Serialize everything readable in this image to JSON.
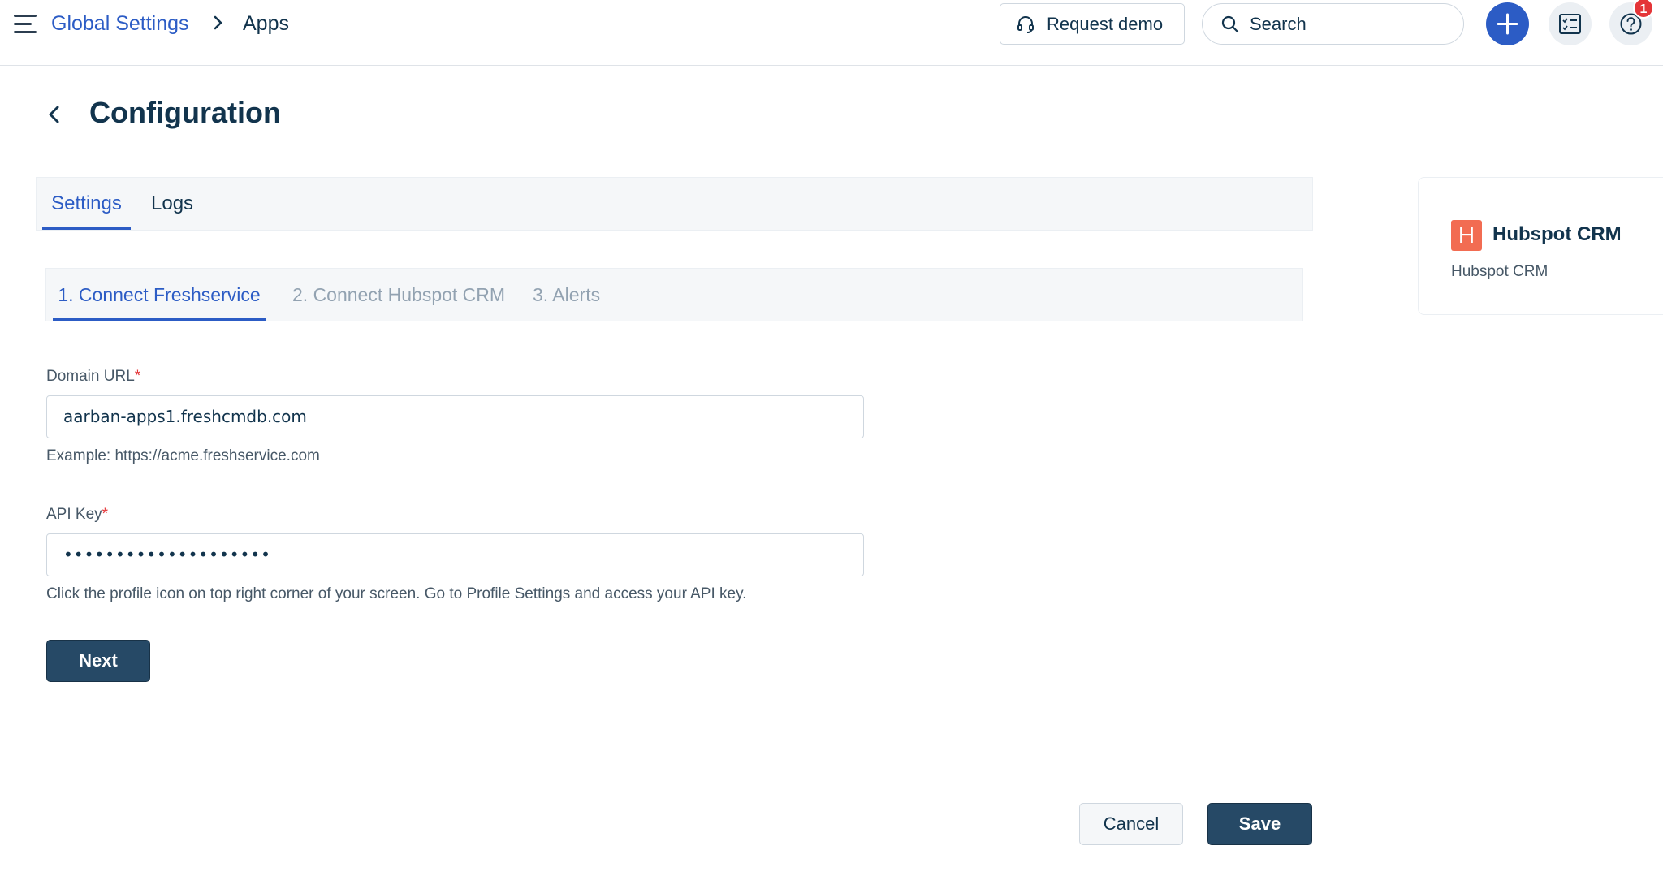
{
  "header": {
    "breadcrumb_parent": "Global Settings",
    "breadcrumb_current": "Apps",
    "request_demo_label": "Request demo",
    "search_placeholder": "Search",
    "notification_count": "1"
  },
  "page": {
    "title": "Configuration"
  },
  "tabs": [
    {
      "label": "Settings",
      "active": true
    },
    {
      "label": "Logs",
      "active": false
    }
  ],
  "steps": [
    {
      "label": "1. Connect Freshservice",
      "active": true
    },
    {
      "label": "2. Connect Hubspot CRM",
      "active": false
    },
    {
      "label": "3. Alerts",
      "active": false
    }
  ],
  "form": {
    "domain_url": {
      "label": "Domain URL",
      "required_mark": "*",
      "value": "aarban-apps1.freshcmdb.com",
      "hint": "Example: https://acme.freshservice.com"
    },
    "api_key": {
      "label": "API Key",
      "required_mark": "*",
      "value": "••••••••••••••••••••",
      "hint": "Click the profile icon on top right corner of your screen. Go to Profile Settings and access your API key."
    },
    "next_label": "Next"
  },
  "footer": {
    "cancel_label": "Cancel",
    "save_label": "Save"
  },
  "app_card": {
    "logo_letter": "H",
    "name": "Hubspot CRM",
    "subtitle": "Hubspot CRM"
  },
  "colors": {
    "accent": "#2c5cc5",
    "primary_button": "#264966",
    "required": "#e43538",
    "hubspot_logo": "#f26c52"
  }
}
